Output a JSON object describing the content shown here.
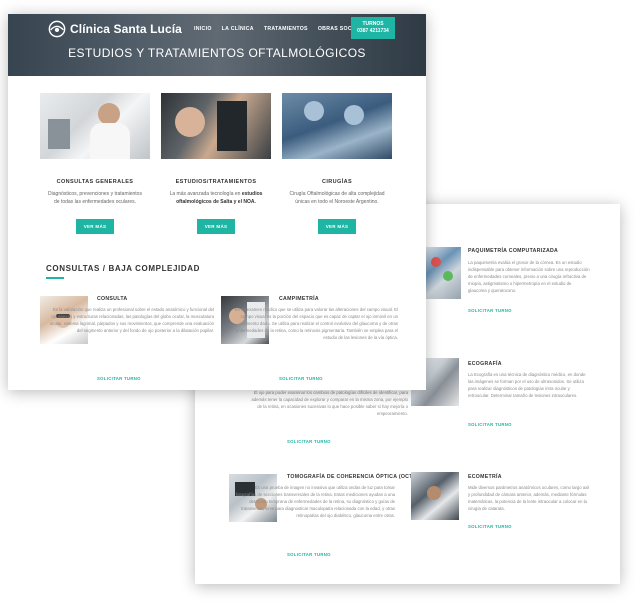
{
  "header": {
    "brand": "Clínica Santa Lucía",
    "nav": [
      "INICIO",
      "LA CLÍNICA",
      "TRATAMIENTOS",
      "OBRAS SOCIALES"
    ],
    "turnos_label": "TURNOS",
    "turnos_phone": "0387 4211734",
    "page_title": "ESTUDIOS Y TRATAMIENTOS OFTALMOLÓGICOS"
  },
  "services": [
    {
      "title": "CONSULTAS GENERALES",
      "desc_1": "Diagnósticos, prevenciones y tratamientos",
      "desc_2": "de todas las enfermedades oculares.",
      "button": "VER MÁS"
    },
    {
      "title": "ESTUDIOS/TRATAMIENTOS",
      "desc_1": "La más avanzada tecnología en ",
      "desc_bold": "estudios oftalmológicos de Salta y el NOA.",
      "button": "VER MÁS"
    },
    {
      "title": "CIRUGÍAS",
      "desc_1": "Cirugía Oftalmológicas de alta complejidad",
      "desc_2": "únicas en todo el Noroeste Argentino.",
      "button": "VER MÁS"
    }
  ],
  "section": {
    "title": "CONSULTAS / BAJA COMPLEJIDAD"
  },
  "front_items": [
    {
      "title": "CONSULTA",
      "desc": "Es la valoración que realiza un profesional sobre el estado anatómico y funcional del ojo anexos y estructuras relacionadas, las patologías del globo ocular, la musculatura ocular, sistema lagrimal, párpados y sus movimientos, que comprende una evaluación del segmento anterior y del fondo de ojo posterior a la dilatación pupilar.",
      "link": "SOLICITAR TURNO"
    },
    {
      "title": "CAMPIMETRÍA",
      "desc": "Es un examen médico que se utiliza para valorar las alteraciones del campo visual. El campo visual es la porción del espacio que es capaz de captar el ojo inmóvil en un momento dado. Se utiliza para realizar el control evolutivo del glaucoma y de otras enfermedades de la retina, como la retinosis pigmentaria. También se emplea para el estudio de las lesiones de la vía óptica.",
      "link": "SOLICITAR TURNO"
    }
  ],
  "back_items": [
    {
      "title": "PAQUIMETRÍA COMPUTARIZADA",
      "desc": "La paquimetría evalúa el grosor de la córnea. Es un estudio indispensable para obtener información sobre una reproducción de enfermedades corneales, previo a una cirugía refractiva de miopía, astigmatismo o hipermetropía en el estudio de glaucoma y queratocono.",
      "link": "SOLICITAR TURNO"
    },
    {
      "title": "ECOGRAFÍA",
      "desc": "La Ecografía es una técnica de diagnóstico médico, en donde las imágenes se forman por el uso de ultrasonidos. Se utiliza para realizar diagnósticos de patologías intra ocular y retroocular. Determinar tamaño de lesiones intraoculares.",
      "link": "SOLICITAR TURNO"
    },
    {
      "title": "",
      "desc": "El ojo para poder examinar los cambios de patologías difíciles de identificar, para además tener la capacidad de explorar y comparar en la misma zona, por ejemplo de la retina, en ocasiones sucesivas lo que hace posible saber si hay mejoría o empeoramiento.",
      "link": "SOLICITAR TURNO"
    },
    {
      "title": "TOMOGRAFÍA DE COHERENCIA ÓPTICA (OCT)",
      "desc": "Es una prueba de imagen no invasiva que utiliza ondas de luz para tomar fotografías de secciones transversales de la retina. Estas mediciones ayudan a una detección temprana de enfermedades de la retina, su diagnóstico y guías de tratamiento, sirve para diagnosticar maculopatía relacionada con la edad, y otras retinopatías del ojo diabético, glaucoma entre otras.",
      "link": "SOLICITAR TURNO"
    },
    {
      "title": "ECOMETRÍA",
      "desc": "Mide diversos parámetros anatómicos oculares, como largo axil y profundidad de cámara anterior, además, mediante fórmulas matemáticas, la potencia de la lente intraocular a colocar en la cirugía de catarata.",
      "link": "SOLICITAR TURNO"
    }
  ],
  "colors": {
    "accent": "#1fb5a5"
  }
}
